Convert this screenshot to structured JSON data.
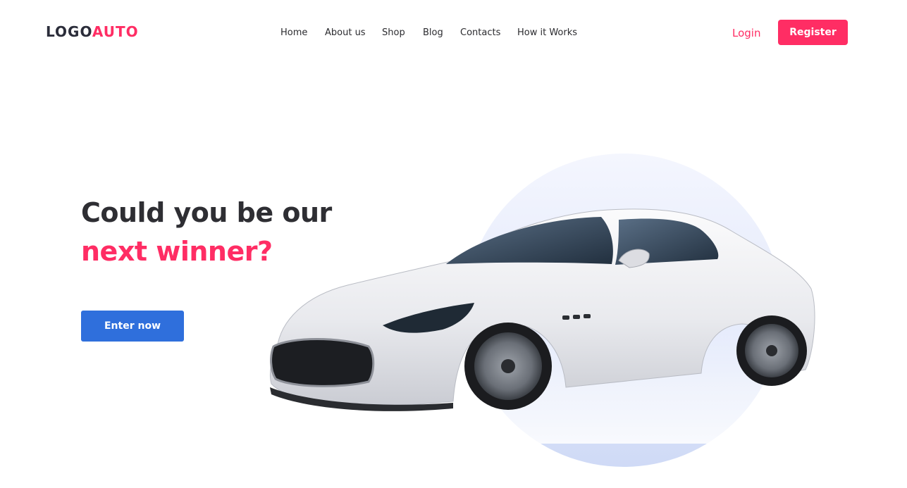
{
  "header": {
    "logo": {
      "part1": "LOGO",
      "part2": "AUTO"
    },
    "nav": [
      {
        "label": "Home"
      },
      {
        "label": "About us"
      },
      {
        "label": "Shop"
      },
      {
        "label": "Blog"
      },
      {
        "label": "Contacts"
      },
      {
        "label": "How it Works"
      }
    ],
    "login_label": "Login",
    "register_label": "Register"
  },
  "hero": {
    "title_line1": "Could you be our",
    "title_line2": "next winner?",
    "cta_label": "Enter now",
    "image": "car-photo"
  },
  "colors": {
    "accent": "#ff2d64",
    "primary_button": "#2f6fdc",
    "text_dark": "#2b2d3a",
    "circle": "#dfe6fb"
  }
}
